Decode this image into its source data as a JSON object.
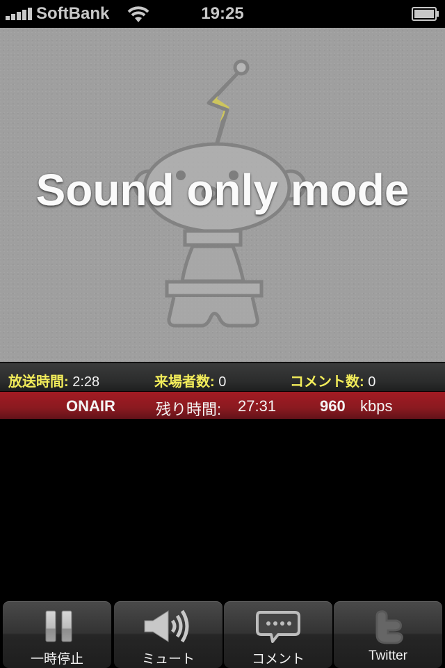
{
  "status_bar": {
    "carrier": "SoftBank",
    "time": "19:25",
    "signal_bars": 5,
    "wifi": true,
    "battery_level": 1.0
  },
  "video": {
    "mode_text": "Sound only mode",
    "placeholder_icon": "robot-mascot-icon",
    "colors": {
      "background": "#9f9f9f",
      "bolt": "#d9cf4e",
      "outline": "#7e7e7e"
    }
  },
  "stats": {
    "broadcast_time": {
      "label": "放送時間:",
      "value": "2:28"
    },
    "visitors": {
      "label": "来場者数:",
      "value": "0"
    },
    "comments": {
      "label": "コメント数:",
      "value": "0"
    },
    "label_color": "#f2ec5a"
  },
  "onair": {
    "status": "ONAIR",
    "remaining_label": "残り時間:",
    "remaining_value": "27:31",
    "bitrate_value": "960",
    "bitrate_unit": "kbps",
    "color": "#a31b23"
  },
  "toolbar": {
    "buttons": [
      {
        "label": "一時停止",
        "icon": "pause-icon"
      },
      {
        "label": "ミュート",
        "icon": "speaker-icon"
      },
      {
        "label": "コメント",
        "icon": "comment-bubble-icon"
      },
      {
        "label": "Twitter",
        "icon": "twitter-icon"
      }
    ]
  }
}
